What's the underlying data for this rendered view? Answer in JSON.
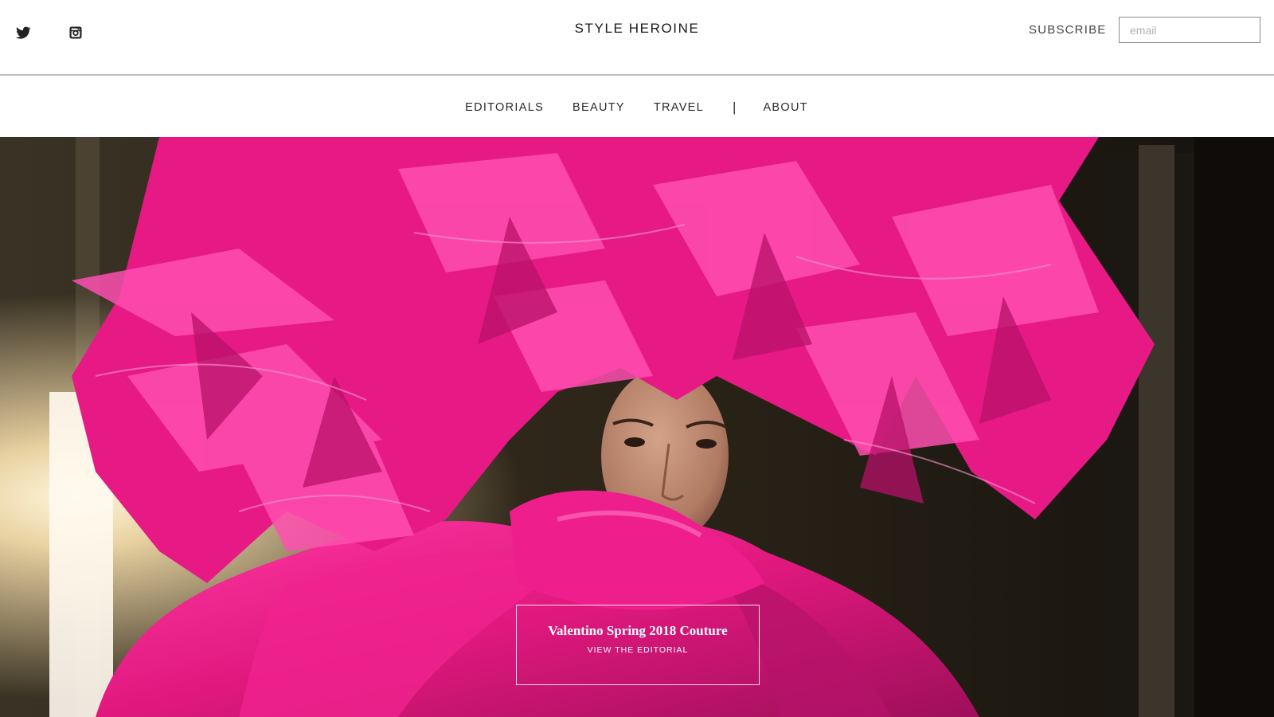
{
  "header": {
    "brand": "STYLE HEROINE",
    "subscribe_label": "SUBSCRIBE",
    "email_placeholder": "email",
    "social": [
      {
        "icon": "twitter-icon"
      },
      {
        "icon": "instagram-icon"
      }
    ]
  },
  "nav": {
    "items": [
      {
        "label": "EDITORIALS"
      },
      {
        "label": "BEAUTY"
      },
      {
        "label": "TRAVEL"
      },
      {
        "label": "ABOUT"
      }
    ],
    "separator": "|"
  },
  "hero": {
    "title": "Valentino Spring 2018 Couture",
    "cta": "VIEW THE EDITORIAL"
  },
  "colors": {
    "accent_pink": "#e0187e",
    "text_dark": "#1a1a1a",
    "divider": "#bdbdbd"
  }
}
